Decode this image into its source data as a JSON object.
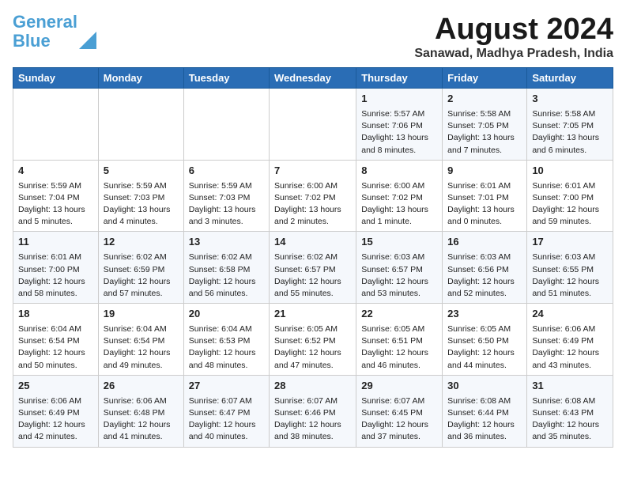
{
  "header": {
    "logo_line1": "General",
    "logo_line2": "Blue",
    "month": "August 2024",
    "location": "Sanawad, Madhya Pradesh, India"
  },
  "days_of_week": [
    "Sunday",
    "Monday",
    "Tuesday",
    "Wednesday",
    "Thursday",
    "Friday",
    "Saturday"
  ],
  "weeks": [
    [
      {
        "day": "",
        "info": ""
      },
      {
        "day": "",
        "info": ""
      },
      {
        "day": "",
        "info": ""
      },
      {
        "day": "",
        "info": ""
      },
      {
        "day": "1",
        "info": "Sunrise: 5:57 AM\nSunset: 7:06 PM\nDaylight: 13 hours\nand 8 minutes."
      },
      {
        "day": "2",
        "info": "Sunrise: 5:58 AM\nSunset: 7:05 PM\nDaylight: 13 hours\nand 7 minutes."
      },
      {
        "day": "3",
        "info": "Sunrise: 5:58 AM\nSunset: 7:05 PM\nDaylight: 13 hours\nand 6 minutes."
      }
    ],
    [
      {
        "day": "4",
        "info": "Sunrise: 5:59 AM\nSunset: 7:04 PM\nDaylight: 13 hours\nand 5 minutes."
      },
      {
        "day": "5",
        "info": "Sunrise: 5:59 AM\nSunset: 7:03 PM\nDaylight: 13 hours\nand 4 minutes."
      },
      {
        "day": "6",
        "info": "Sunrise: 5:59 AM\nSunset: 7:03 PM\nDaylight: 13 hours\nand 3 minutes."
      },
      {
        "day": "7",
        "info": "Sunrise: 6:00 AM\nSunset: 7:02 PM\nDaylight: 13 hours\nand 2 minutes."
      },
      {
        "day": "8",
        "info": "Sunrise: 6:00 AM\nSunset: 7:02 PM\nDaylight: 13 hours\nand 1 minute."
      },
      {
        "day": "9",
        "info": "Sunrise: 6:01 AM\nSunset: 7:01 PM\nDaylight: 13 hours\nand 0 minutes."
      },
      {
        "day": "10",
        "info": "Sunrise: 6:01 AM\nSunset: 7:00 PM\nDaylight: 12 hours\nand 59 minutes."
      }
    ],
    [
      {
        "day": "11",
        "info": "Sunrise: 6:01 AM\nSunset: 7:00 PM\nDaylight: 12 hours\nand 58 minutes."
      },
      {
        "day": "12",
        "info": "Sunrise: 6:02 AM\nSunset: 6:59 PM\nDaylight: 12 hours\nand 57 minutes."
      },
      {
        "day": "13",
        "info": "Sunrise: 6:02 AM\nSunset: 6:58 PM\nDaylight: 12 hours\nand 56 minutes."
      },
      {
        "day": "14",
        "info": "Sunrise: 6:02 AM\nSunset: 6:57 PM\nDaylight: 12 hours\nand 55 minutes."
      },
      {
        "day": "15",
        "info": "Sunrise: 6:03 AM\nSunset: 6:57 PM\nDaylight: 12 hours\nand 53 minutes."
      },
      {
        "day": "16",
        "info": "Sunrise: 6:03 AM\nSunset: 6:56 PM\nDaylight: 12 hours\nand 52 minutes."
      },
      {
        "day": "17",
        "info": "Sunrise: 6:03 AM\nSunset: 6:55 PM\nDaylight: 12 hours\nand 51 minutes."
      }
    ],
    [
      {
        "day": "18",
        "info": "Sunrise: 6:04 AM\nSunset: 6:54 PM\nDaylight: 12 hours\nand 50 minutes."
      },
      {
        "day": "19",
        "info": "Sunrise: 6:04 AM\nSunset: 6:54 PM\nDaylight: 12 hours\nand 49 minutes."
      },
      {
        "day": "20",
        "info": "Sunrise: 6:04 AM\nSunset: 6:53 PM\nDaylight: 12 hours\nand 48 minutes."
      },
      {
        "day": "21",
        "info": "Sunrise: 6:05 AM\nSunset: 6:52 PM\nDaylight: 12 hours\nand 47 minutes."
      },
      {
        "day": "22",
        "info": "Sunrise: 6:05 AM\nSunset: 6:51 PM\nDaylight: 12 hours\nand 46 minutes."
      },
      {
        "day": "23",
        "info": "Sunrise: 6:05 AM\nSunset: 6:50 PM\nDaylight: 12 hours\nand 44 minutes."
      },
      {
        "day": "24",
        "info": "Sunrise: 6:06 AM\nSunset: 6:49 PM\nDaylight: 12 hours\nand 43 minutes."
      }
    ],
    [
      {
        "day": "25",
        "info": "Sunrise: 6:06 AM\nSunset: 6:49 PM\nDaylight: 12 hours\nand 42 minutes."
      },
      {
        "day": "26",
        "info": "Sunrise: 6:06 AM\nSunset: 6:48 PM\nDaylight: 12 hours\nand 41 minutes."
      },
      {
        "day": "27",
        "info": "Sunrise: 6:07 AM\nSunset: 6:47 PM\nDaylight: 12 hours\nand 40 minutes."
      },
      {
        "day": "28",
        "info": "Sunrise: 6:07 AM\nSunset: 6:46 PM\nDaylight: 12 hours\nand 38 minutes."
      },
      {
        "day": "29",
        "info": "Sunrise: 6:07 AM\nSunset: 6:45 PM\nDaylight: 12 hours\nand 37 minutes."
      },
      {
        "day": "30",
        "info": "Sunrise: 6:08 AM\nSunset: 6:44 PM\nDaylight: 12 hours\nand 36 minutes."
      },
      {
        "day": "31",
        "info": "Sunrise: 6:08 AM\nSunset: 6:43 PM\nDaylight: 12 hours\nand 35 minutes."
      }
    ]
  ]
}
